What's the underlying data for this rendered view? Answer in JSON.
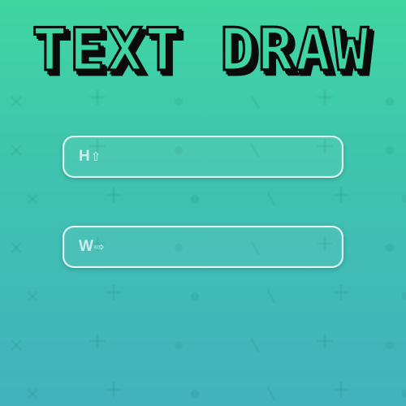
{
  "app": {
    "title": "TEXT DRAW"
  },
  "fields": {
    "height": {
      "label": "H",
      "icon": "arrow-up-icon",
      "value": ""
    },
    "width": {
      "label": "W",
      "icon": "arrow-right-icon",
      "value": ""
    }
  },
  "colors": {
    "background_top": "#3fd6a0",
    "background_bottom": "#41b2bd",
    "title_outline": "#0b0b0b",
    "field_border": "#ffffff"
  }
}
